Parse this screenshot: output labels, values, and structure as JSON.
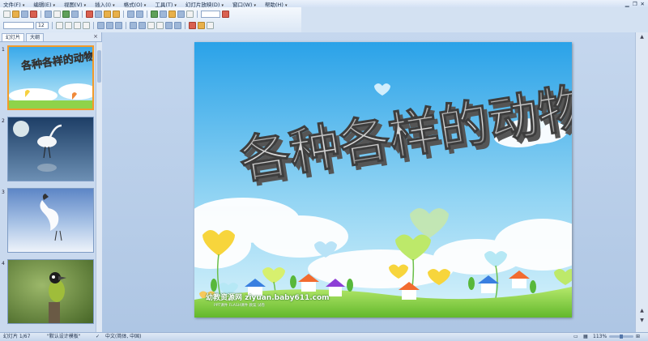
{
  "menu": [
    "文件(F)",
    "编辑(E)",
    "视图(V)",
    "插入(I)",
    "格式(O)",
    "工具(T)",
    "幻灯片放映(D)",
    "窗口(W)",
    "帮助(H)"
  ],
  "toolbar": {
    "font_size_value": "12"
  },
  "left_panel": {
    "tabs": [
      "幻灯片",
      "大纲"
    ],
    "close_glyph": "×",
    "thumbnails": [
      {
        "number": "1",
        "title": "各种各样的动物",
        "selected": true
      },
      {
        "number": "2",
        "title": "",
        "selected": false
      },
      {
        "number": "3",
        "title": "",
        "selected": false
      },
      {
        "number": "4",
        "title": "",
        "selected": false
      }
    ]
  },
  "slide": {
    "title": "各种各样的动物",
    "watermark": "幼教资源网 ziyuan.baby611.com",
    "watermark_small": "PPT课件 FLASH课件 教案 试卷"
  },
  "status": {
    "slide_counter": "幻灯片 1/67",
    "template": "\"默认设计模板\"",
    "language": "中文(简体, 中国)",
    "zoom": "113%"
  },
  "colors": {
    "sky_top": "#39a9ea",
    "sky_bottom": "#bfe8f7",
    "grass": "#8fd34a",
    "selection": "#f29b2b"
  }
}
